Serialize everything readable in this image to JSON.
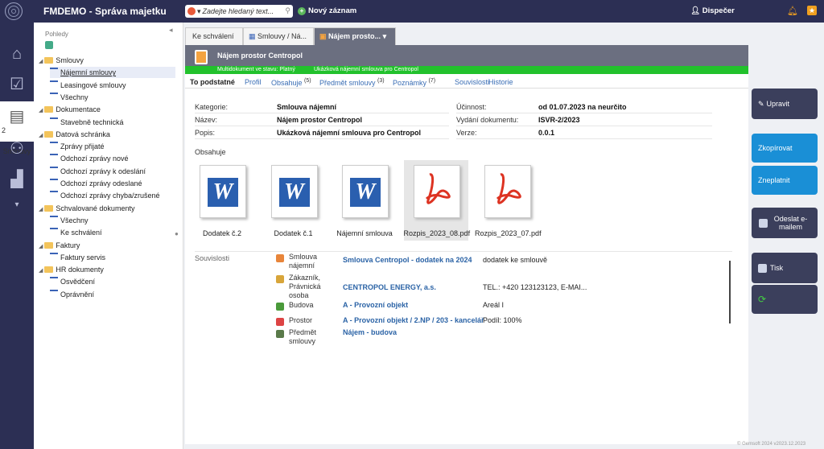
{
  "header": {
    "app_title": "FMDEMO - Správa majetku",
    "search_placeholder": "Zadejte hledaný text...",
    "new_record": "Nový záznam",
    "user": "Dispečer"
  },
  "leftnav": {
    "badge": "2",
    "active_label": "Smlouvy",
    "icons": [
      "home-icon",
      "task-check-icon",
      "document-icon",
      "person-icon",
      "factory-icon",
      "chevron-down-icon"
    ]
  },
  "tree": {
    "title": "Pohledy",
    "items": [
      {
        "label": "Smlouvy",
        "type": "folder",
        "level": 0
      },
      {
        "label": "Nájemní smlouvy",
        "type": "doc",
        "level": 1,
        "selected": true
      },
      {
        "label": "Leasingové smlouvy",
        "type": "doc",
        "level": 1
      },
      {
        "label": "Všechny",
        "type": "doc",
        "level": 1
      },
      {
        "label": "Dokumentace",
        "type": "folder",
        "level": 0
      },
      {
        "label": "Stavebně technická",
        "type": "doc",
        "level": 1
      },
      {
        "label": "Datová schránka",
        "type": "folder",
        "level": 0
      },
      {
        "label": "Zprávy přijaté",
        "type": "doc",
        "level": 1
      },
      {
        "label": "Odchozí zprávy nové",
        "type": "doc",
        "level": 1
      },
      {
        "label": "Odchozí zprávy k odeslání",
        "type": "doc",
        "level": 1
      },
      {
        "label": "Odchozí zprávy odeslané",
        "type": "doc",
        "level": 1
      },
      {
        "label": "Odchozí zprávy chyba/zrušené",
        "type": "doc",
        "level": 1
      },
      {
        "label": "Schvalované dokumenty",
        "type": "folder",
        "level": 0
      },
      {
        "label": "Všechny",
        "type": "doc",
        "level": 1
      },
      {
        "label": "Ke schválení",
        "type": "doc",
        "level": 1
      },
      {
        "label": "Faktury",
        "type": "folder",
        "level": 0
      },
      {
        "label": "Faktury servis",
        "type": "doc",
        "level": 1
      },
      {
        "label": "HR dokumenty",
        "type": "folder",
        "level": 0
      },
      {
        "label": "Osvědčení",
        "type": "doc",
        "level": 1
      },
      {
        "label": "Oprávnění",
        "type": "doc",
        "level": 1
      }
    ]
  },
  "tabs": [
    "Ke schválení",
    "Smlouvy / Ná...",
    "Nájem prosto..."
  ],
  "record": {
    "title": "Nájem prostor Centropol",
    "status": "Multidokument ve stavu: Platný",
    "subtitle": "Ukázková nájemní smlouva pro Centropol"
  },
  "subtabs": [
    {
      "label": "To podstatné",
      "count": ""
    },
    {
      "label": "Profil",
      "count": ""
    },
    {
      "label": "Obsahuje",
      "count": "(5)"
    },
    {
      "label": "Předmět smlouvy",
      "count": "(3)"
    },
    {
      "label": "Poznámky",
      "count": "(7)"
    },
    {
      "label": "Souvislosti",
      "count": ""
    },
    {
      "label": "Historie",
      "count": ""
    }
  ],
  "fields": {
    "kategorie_label": "Kategorie:",
    "kategorie": "Smlouva nájemní",
    "nazev_label": "Název:",
    "nazev": "Nájem prostor Centropol",
    "popis_label": "Popis:",
    "popis": "Ukázková nájemní smlouva pro Centropol",
    "ucinnost_label": "Účinnost:",
    "ucinnost": "od 01.07.2023 na neurčito",
    "vydani_label": "Vydání dokumentu:",
    "vydani": "ISVR-2/2023",
    "verze_label": "Verze:",
    "verze": "0.0.1"
  },
  "obsahuje": {
    "label": "Obsahuje",
    "files": [
      {
        "name": "Dodatek č.2",
        "kind": "word"
      },
      {
        "name": "Dodatek č.1",
        "kind": "word"
      },
      {
        "name": "Nájemní smlouva",
        "kind": "word"
      },
      {
        "name": "Rozpis_2023_08.pdf",
        "kind": "pdf"
      },
      {
        "name": "Rozpis_2023_07.pdf",
        "kind": "pdf"
      }
    ]
  },
  "souvislosti": {
    "label": "Souvislosti",
    "rows": [
      {
        "type": "Smlouva nájemní",
        "link": "Smlouva Centropol - dodatek na 2024",
        "note": "dodatek ke smlouvě",
        "color": "#e8853a"
      },
      {
        "type": "Zákazník, Právnická osoba",
        "link": "CENTROPOL ENERGY, a.s.",
        "note": "TEL.: +420 123123123, E-MAI...",
        "color": "#d8a53a"
      },
      {
        "type": "Budova",
        "link": "A - Provozní objekt",
        "note": "Areál I",
        "color": "#4a9a3a"
      },
      {
        "type": "Prostor",
        "link": "A - Provozní objekt / 2.NP / 203 - kancelář",
        "note": "Podíl: 100%",
        "color": "#d44"
      },
      {
        "type": "Předmět smlouvy",
        "link": "Nájem - budova",
        "note": "",
        "color": "#5a7a4a"
      }
    ]
  },
  "actions": {
    "upravit": "Upravit",
    "zkopirovat": "Zkopírovat",
    "zneplatnit": "Zneplatnit",
    "odeslat": "Odeslat e-mailem",
    "tisk": "Tisk"
  },
  "footer": "© Gemsoft 2024 v2023.12.2023"
}
